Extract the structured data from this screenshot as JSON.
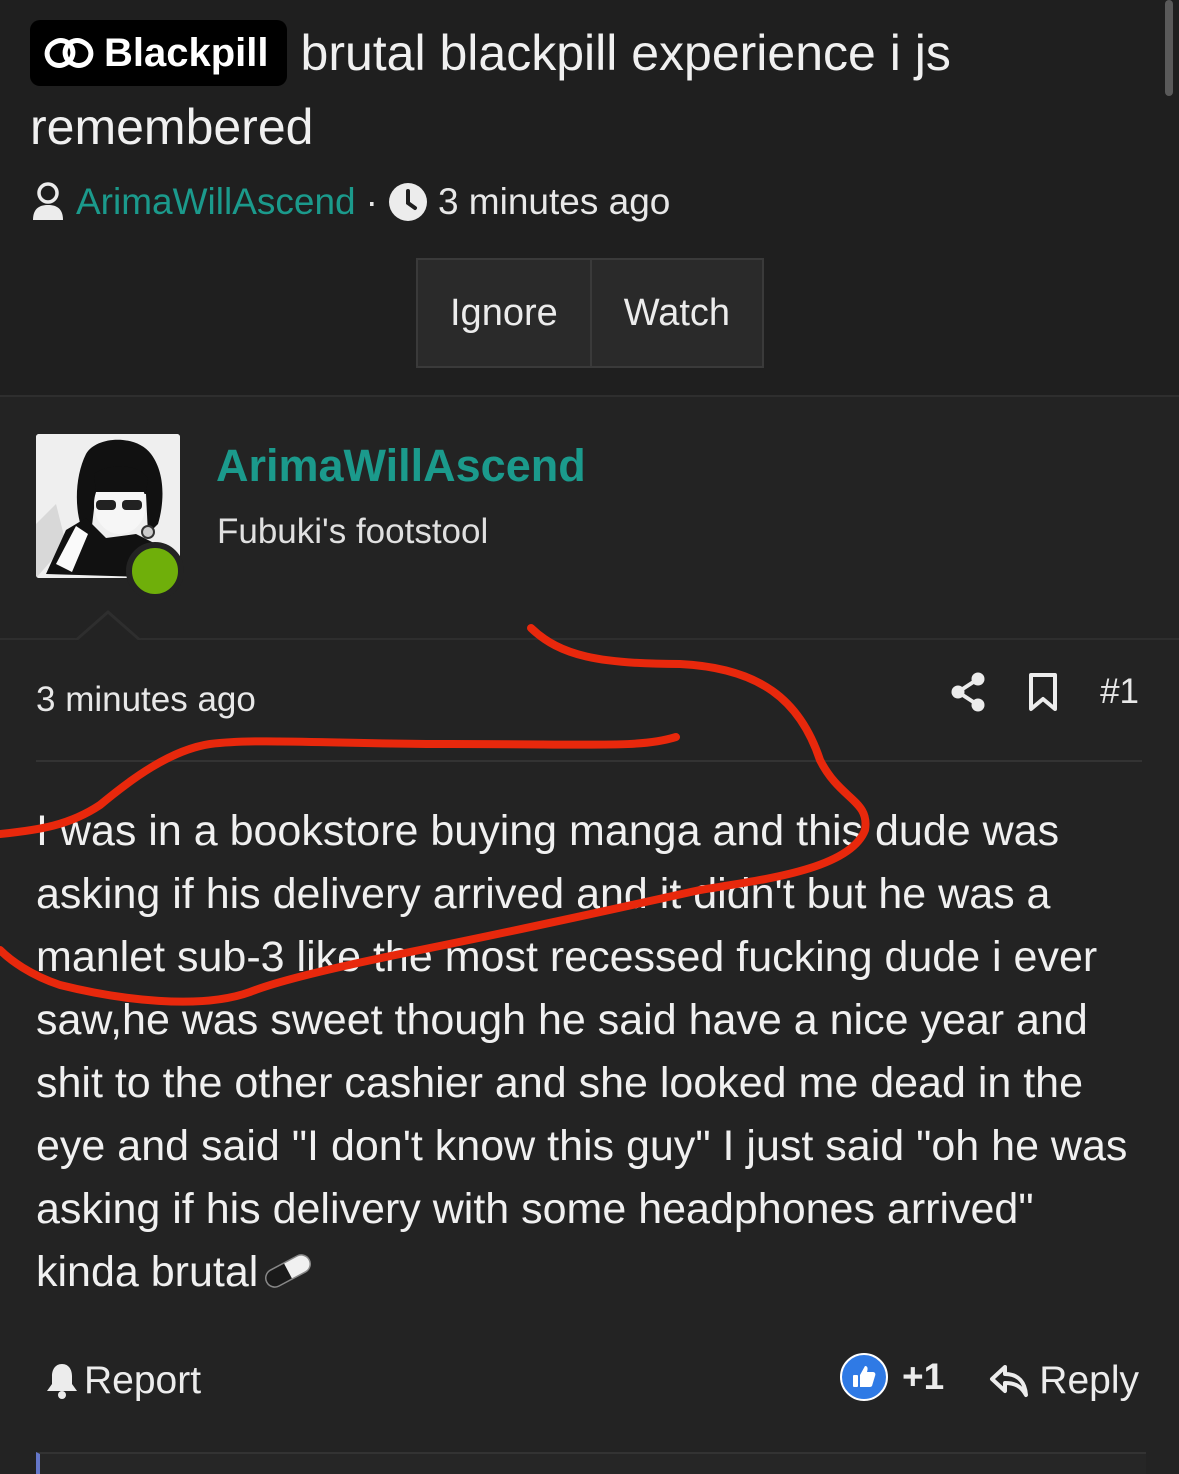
{
  "thread": {
    "prefix": "Blackpill",
    "title": "brutal blackpill experience i js remembered",
    "author": "ArimaWillAscend",
    "separator": "·",
    "time": "3 minutes ago",
    "buttons": {
      "ignore": "Ignore",
      "watch": "Watch"
    }
  },
  "post": {
    "username": "ArimaWillAscend",
    "user_title": "Fubuki's footstool",
    "time": "3 minutes ago",
    "number": "#1",
    "body": "I was in a bookstore buying manga and this dude was asking if his delivery arrived and it didn't but he was a manlet sub-3 like the most recessed fucking dude i ever saw,he was sweet though he said have a nice year and shit to the other cashier and she looked me dead in the eye and said \"I don't know this guy\" I just said \"oh he was asking if his delivery with some headphones arrived\" kinda brutal",
    "online": true
  },
  "footer": {
    "report": "Report",
    "reaction_count": "+1",
    "reply": "Reply"
  },
  "icons": {
    "prefix": "blackpill-logo-icon",
    "author": "user-icon",
    "time": "clock-icon",
    "share": "share-icon",
    "bookmark": "bookmark-icon",
    "report": "alert-icon",
    "reaction": "like-icon",
    "reply": "reply-icon",
    "body_end": "pill-emoji-icon"
  },
  "colors": {
    "accent": "#1b9a8c",
    "online": "#6faf0a",
    "annotation": "#e8280c",
    "like": "#2f7ae5"
  }
}
